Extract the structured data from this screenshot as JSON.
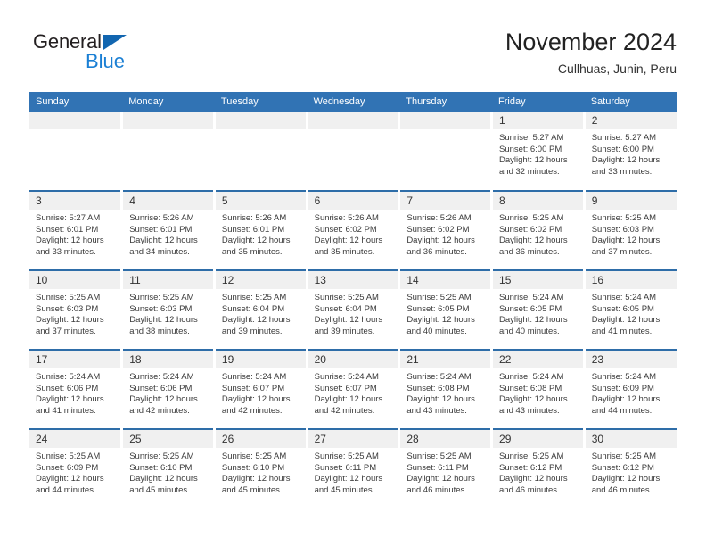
{
  "brand": {
    "name_part1": "General",
    "name_part2": "Blue",
    "triangle_color": "#1266b0",
    "blue_color": "#1a7fd4"
  },
  "header": {
    "title": "November 2024",
    "location": "Cullhuas, Junin, Peru"
  },
  "theme": {
    "header_blue": "#3173b4",
    "row_divider_blue": "#2e6da8",
    "daynum_band": "#f0f0f0"
  },
  "weekday_headers": [
    "Sunday",
    "Monday",
    "Tuesday",
    "Wednesday",
    "Thursday",
    "Friday",
    "Saturday"
  ],
  "weeks": [
    [
      {
        "day": "",
        "empty": true
      },
      {
        "day": "",
        "empty": true
      },
      {
        "day": "",
        "empty": true
      },
      {
        "day": "",
        "empty": true
      },
      {
        "day": "",
        "empty": true
      },
      {
        "day": "1",
        "sunrise": "Sunrise: 5:27 AM",
        "sunset": "Sunset: 6:00 PM",
        "daylight_1": "Daylight: 12 hours",
        "daylight_2": "and 32 minutes."
      },
      {
        "day": "2",
        "sunrise": "Sunrise: 5:27 AM",
        "sunset": "Sunset: 6:00 PM",
        "daylight_1": "Daylight: 12 hours",
        "daylight_2": "and 33 minutes."
      }
    ],
    [
      {
        "day": "3",
        "sunrise": "Sunrise: 5:27 AM",
        "sunset": "Sunset: 6:01 PM",
        "daylight_1": "Daylight: 12 hours",
        "daylight_2": "and 33 minutes."
      },
      {
        "day": "4",
        "sunrise": "Sunrise: 5:26 AM",
        "sunset": "Sunset: 6:01 PM",
        "daylight_1": "Daylight: 12 hours",
        "daylight_2": "and 34 minutes."
      },
      {
        "day": "5",
        "sunrise": "Sunrise: 5:26 AM",
        "sunset": "Sunset: 6:01 PM",
        "daylight_1": "Daylight: 12 hours",
        "daylight_2": "and 35 minutes."
      },
      {
        "day": "6",
        "sunrise": "Sunrise: 5:26 AM",
        "sunset": "Sunset: 6:02 PM",
        "daylight_1": "Daylight: 12 hours",
        "daylight_2": "and 35 minutes."
      },
      {
        "day": "7",
        "sunrise": "Sunrise: 5:26 AM",
        "sunset": "Sunset: 6:02 PM",
        "daylight_1": "Daylight: 12 hours",
        "daylight_2": "and 36 minutes."
      },
      {
        "day": "8",
        "sunrise": "Sunrise: 5:25 AM",
        "sunset": "Sunset: 6:02 PM",
        "daylight_1": "Daylight: 12 hours",
        "daylight_2": "and 36 minutes."
      },
      {
        "day": "9",
        "sunrise": "Sunrise: 5:25 AM",
        "sunset": "Sunset: 6:03 PM",
        "daylight_1": "Daylight: 12 hours",
        "daylight_2": "and 37 minutes."
      }
    ],
    [
      {
        "day": "10",
        "sunrise": "Sunrise: 5:25 AM",
        "sunset": "Sunset: 6:03 PM",
        "daylight_1": "Daylight: 12 hours",
        "daylight_2": "and 37 minutes."
      },
      {
        "day": "11",
        "sunrise": "Sunrise: 5:25 AM",
        "sunset": "Sunset: 6:03 PM",
        "daylight_1": "Daylight: 12 hours",
        "daylight_2": "and 38 minutes."
      },
      {
        "day": "12",
        "sunrise": "Sunrise: 5:25 AM",
        "sunset": "Sunset: 6:04 PM",
        "daylight_1": "Daylight: 12 hours",
        "daylight_2": "and 39 minutes."
      },
      {
        "day": "13",
        "sunrise": "Sunrise: 5:25 AM",
        "sunset": "Sunset: 6:04 PM",
        "daylight_1": "Daylight: 12 hours",
        "daylight_2": "and 39 minutes."
      },
      {
        "day": "14",
        "sunrise": "Sunrise: 5:25 AM",
        "sunset": "Sunset: 6:05 PM",
        "daylight_1": "Daylight: 12 hours",
        "daylight_2": "and 40 minutes."
      },
      {
        "day": "15",
        "sunrise": "Sunrise: 5:24 AM",
        "sunset": "Sunset: 6:05 PM",
        "daylight_1": "Daylight: 12 hours",
        "daylight_2": "and 40 minutes."
      },
      {
        "day": "16",
        "sunrise": "Sunrise: 5:24 AM",
        "sunset": "Sunset: 6:05 PM",
        "daylight_1": "Daylight: 12 hours",
        "daylight_2": "and 41 minutes."
      }
    ],
    [
      {
        "day": "17",
        "sunrise": "Sunrise: 5:24 AM",
        "sunset": "Sunset: 6:06 PM",
        "daylight_1": "Daylight: 12 hours",
        "daylight_2": "and 41 minutes."
      },
      {
        "day": "18",
        "sunrise": "Sunrise: 5:24 AM",
        "sunset": "Sunset: 6:06 PM",
        "daylight_1": "Daylight: 12 hours",
        "daylight_2": "and 42 minutes."
      },
      {
        "day": "19",
        "sunrise": "Sunrise: 5:24 AM",
        "sunset": "Sunset: 6:07 PM",
        "daylight_1": "Daylight: 12 hours",
        "daylight_2": "and 42 minutes."
      },
      {
        "day": "20",
        "sunrise": "Sunrise: 5:24 AM",
        "sunset": "Sunset: 6:07 PM",
        "daylight_1": "Daylight: 12 hours",
        "daylight_2": "and 42 minutes."
      },
      {
        "day": "21",
        "sunrise": "Sunrise: 5:24 AM",
        "sunset": "Sunset: 6:08 PM",
        "daylight_1": "Daylight: 12 hours",
        "daylight_2": "and 43 minutes."
      },
      {
        "day": "22",
        "sunrise": "Sunrise: 5:24 AM",
        "sunset": "Sunset: 6:08 PM",
        "daylight_1": "Daylight: 12 hours",
        "daylight_2": "and 43 minutes."
      },
      {
        "day": "23",
        "sunrise": "Sunrise: 5:24 AM",
        "sunset": "Sunset: 6:09 PM",
        "daylight_1": "Daylight: 12 hours",
        "daylight_2": "and 44 minutes."
      }
    ],
    [
      {
        "day": "24",
        "sunrise": "Sunrise: 5:25 AM",
        "sunset": "Sunset: 6:09 PM",
        "daylight_1": "Daylight: 12 hours",
        "daylight_2": "and 44 minutes."
      },
      {
        "day": "25",
        "sunrise": "Sunrise: 5:25 AM",
        "sunset": "Sunset: 6:10 PM",
        "daylight_1": "Daylight: 12 hours",
        "daylight_2": "and 45 minutes."
      },
      {
        "day": "26",
        "sunrise": "Sunrise: 5:25 AM",
        "sunset": "Sunset: 6:10 PM",
        "daylight_1": "Daylight: 12 hours",
        "daylight_2": "and 45 minutes."
      },
      {
        "day": "27",
        "sunrise": "Sunrise: 5:25 AM",
        "sunset": "Sunset: 6:11 PM",
        "daylight_1": "Daylight: 12 hours",
        "daylight_2": "and 45 minutes."
      },
      {
        "day": "28",
        "sunrise": "Sunrise: 5:25 AM",
        "sunset": "Sunset: 6:11 PM",
        "daylight_1": "Daylight: 12 hours",
        "daylight_2": "and 46 minutes."
      },
      {
        "day": "29",
        "sunrise": "Sunrise: 5:25 AM",
        "sunset": "Sunset: 6:12 PM",
        "daylight_1": "Daylight: 12 hours",
        "daylight_2": "and 46 minutes."
      },
      {
        "day": "30",
        "sunrise": "Sunrise: 5:25 AM",
        "sunset": "Sunset: 6:12 PM",
        "daylight_1": "Daylight: 12 hours",
        "daylight_2": "and 46 minutes."
      }
    ]
  ]
}
